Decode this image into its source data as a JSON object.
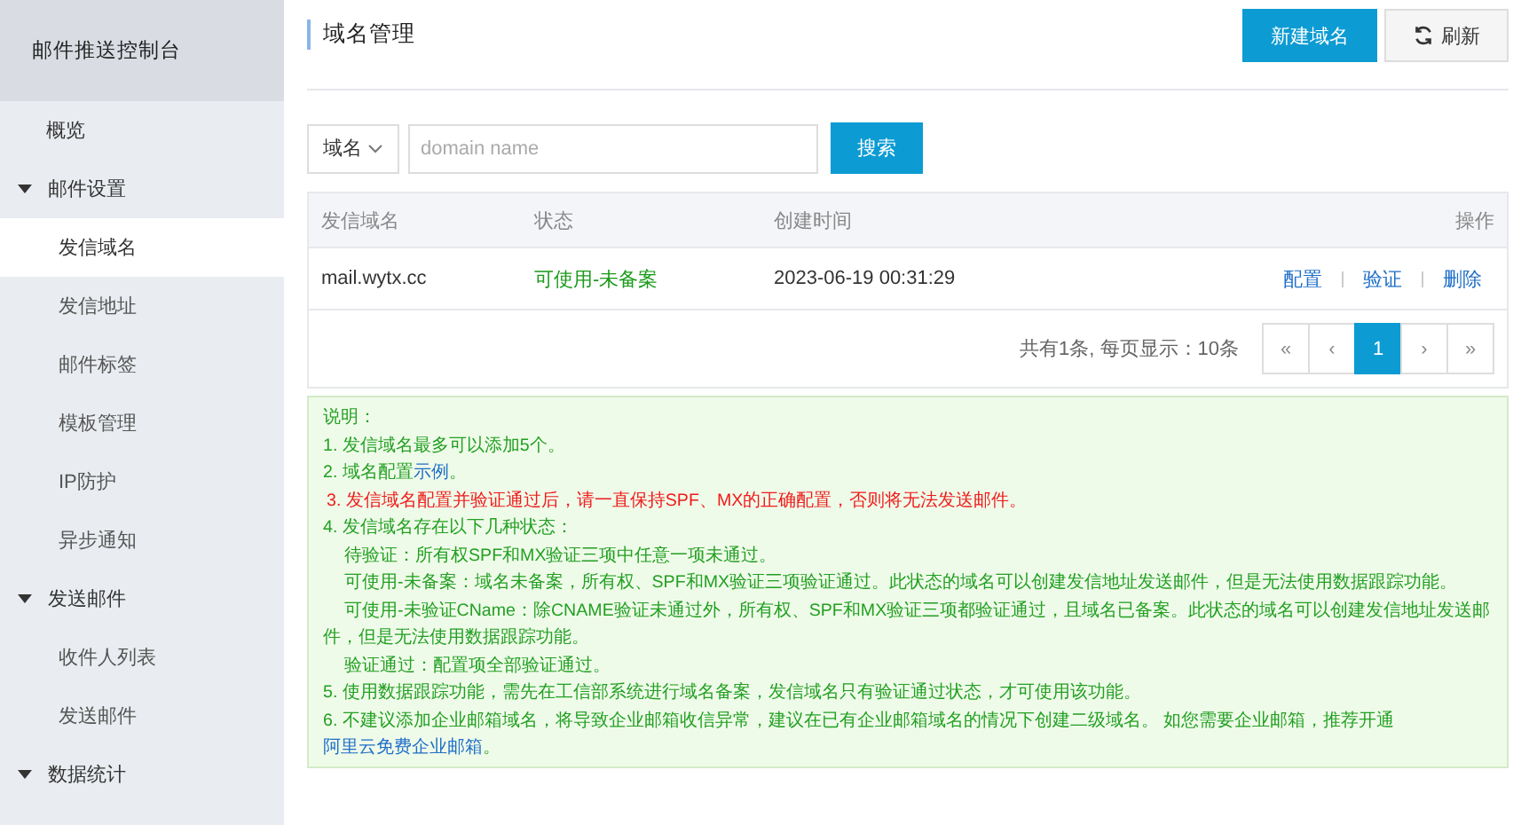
{
  "sidebar": {
    "title": "邮件推送控制台",
    "items": [
      {
        "label": "概览",
        "selected": false
      },
      {
        "label": "邮件设置",
        "expanded": true,
        "children": [
          {
            "label": "发信域名",
            "selected": true
          },
          {
            "label": "发信地址",
            "selected": false
          },
          {
            "label": "邮件标签",
            "selected": false
          },
          {
            "label": "模板管理",
            "selected": false
          },
          {
            "label": "IP防护",
            "selected": false
          },
          {
            "label": "异步通知",
            "selected": false
          }
        ]
      },
      {
        "label": "发送邮件",
        "expanded": true,
        "children": [
          {
            "label": "收件人列表",
            "selected": false
          },
          {
            "label": "发送邮件",
            "selected": false
          }
        ]
      },
      {
        "label": "数据统计",
        "expanded": true
      }
    ]
  },
  "header": {
    "title": "域名管理",
    "buttons": [
      {
        "kind": "primary",
        "label": "新建域名"
      },
      {
        "kind": "refresh",
        "label": "刷新"
      }
    ]
  },
  "search": {
    "select": "域名",
    "placeholder": "domain name",
    "button": "搜索"
  },
  "table": {
    "columns": [
      "发信域名",
      "状态",
      "创建时间",
      "操作"
    ],
    "rows": [
      {
        "domain": "mail.wytx.cc",
        "status": "可使用-未备案",
        "created": "2023-06-19 00:31:29",
        "actions": [
          "配置",
          "验证",
          "删除"
        ]
      }
    ]
  },
  "pagination": {
    "summary": "共有1条, 每页显示：10条",
    "pages": [
      {
        "label": "«",
        "selected": false
      },
      {
        "label": "‹",
        "selected": false
      },
      {
        "label": "1",
        "selected": true
      },
      {
        "label": "›",
        "selected": false
      },
      {
        "label": "»",
        "selected": false
      }
    ]
  },
  "notes": [
    {
      "kind": "normal",
      "text": "说明："
    },
    {
      "kind": "normal",
      "text": "1. 发信域名最多可以添加5个。"
    },
    {
      "kind": "normal",
      "text": "2. 域名配置",
      "link": "示例",
      "after": "。"
    },
    {
      "kind": "warning",
      "text": "3. 发信域名配置并验证通过后，请一直保持SPF、MX的正确配置，否则将无法发送邮件。"
    },
    {
      "kind": "normal",
      "text": "4. 发信域名存在以下几种状态："
    },
    {
      "kind": "sub",
      "text": "待验证：所有权SPF和MX验证三项中任意一项未通过。"
    },
    {
      "kind": "sub",
      "text": "可使用-未备案：域名未备案，所有权、SPF和MX验证三项验证通过。此状态的域名可以创建发信地址发送邮件，但是无法使用数据跟踪功能。"
    },
    {
      "kind": "sub",
      "text": "可使用-未验证CName：除CNAME验证未通过外，所有权、SPF和MX验证三项都验证通过，且域名已备案。此状态的域名可以创建发信地址发送邮件，但是无法使用数据跟踪功能。"
    },
    {
      "kind": "sub",
      "text": "验证通过：配置项全部验证通过。"
    },
    {
      "kind": "normal",
      "text": "5. 使用数据跟踪功能，需先在工信部系统进行域名备案，发信域名只有验证通过状态，才可使用该功能。"
    },
    {
      "kind": "normal",
      "text": "6. 不建议添加企业邮箱域名，将导致企业邮箱收信异常，建议在已有企业邮箱域名的情况下创建二级域名。 如您需要企业邮箱，推荐开通",
      "link": "阿里云免费企业邮箱",
      "after": "。"
    }
  ]
}
